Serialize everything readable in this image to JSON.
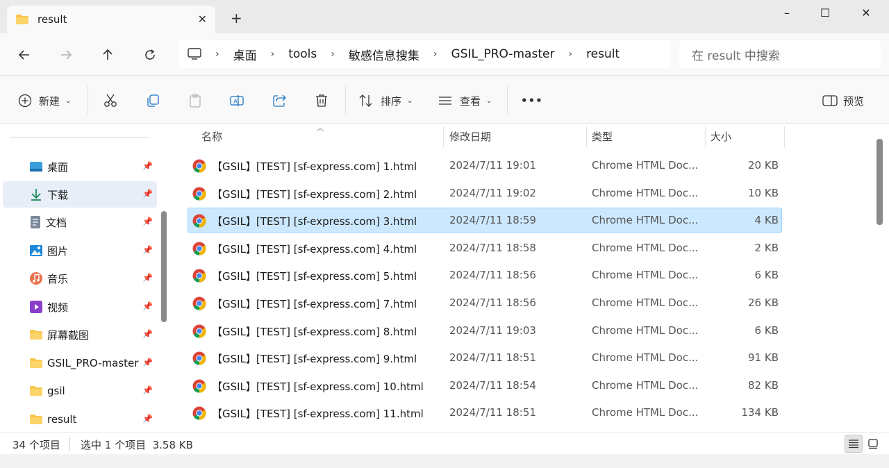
{
  "window": {
    "tab_title": "result",
    "new_tab": "+",
    "minimize": "–",
    "maximize": "☐",
    "close": "✕"
  },
  "address": {
    "crumbs": [
      "桌面",
      "tools",
      "敏感信息搜集",
      "GSIL_PRO-master",
      "result"
    ],
    "separator": "›"
  },
  "search": {
    "placeholder": "在 result 中搜索"
  },
  "toolbar": {
    "new_label": "新建",
    "sort_label": "排序",
    "view_label": "查看",
    "more_label": "•••",
    "preview_label": "预览"
  },
  "sidebar": {
    "items": [
      {
        "label": "桌面",
        "icon": "desktop-icon"
      },
      {
        "label": "下载",
        "icon": "download-icon"
      },
      {
        "label": "文档",
        "icon": "document-icon"
      },
      {
        "label": "图片",
        "icon": "picture-icon"
      },
      {
        "label": "音乐",
        "icon": "music-icon"
      },
      {
        "label": "视频",
        "icon": "video-icon"
      },
      {
        "label": "屏幕截图",
        "icon": "folder-icon"
      },
      {
        "label": "GSIL_PRO-master",
        "icon": "folder-icon"
      },
      {
        "label": "gsil",
        "icon": "folder-icon"
      },
      {
        "label": "result",
        "icon": "folder-icon"
      }
    ],
    "selected_index": 1
  },
  "columns": {
    "name": "名称",
    "date": "修改日期",
    "type": "类型",
    "size": "大小"
  },
  "files": [
    {
      "name": "【GSIL】[TEST] [sf-express.com] 1.html",
      "date": "2024/7/11 19:01",
      "type": "Chrome HTML Doc...",
      "size": "20 KB"
    },
    {
      "name": "【GSIL】[TEST] [sf-express.com] 2.html",
      "date": "2024/7/11 19:02",
      "type": "Chrome HTML Doc...",
      "size": "10 KB"
    },
    {
      "name": "【GSIL】[TEST] [sf-express.com] 3.html",
      "date": "2024/7/11 18:59",
      "type": "Chrome HTML Doc...",
      "size": "4 KB"
    },
    {
      "name": "【GSIL】[TEST] [sf-express.com] 4.html",
      "date": "2024/7/11 18:58",
      "type": "Chrome HTML Doc...",
      "size": "2 KB"
    },
    {
      "name": "【GSIL】[TEST] [sf-express.com] 5.html",
      "date": "2024/7/11 18:56",
      "type": "Chrome HTML Doc...",
      "size": "6 KB"
    },
    {
      "name": "【GSIL】[TEST] [sf-express.com] 7.html",
      "date": "2024/7/11 18:56",
      "type": "Chrome HTML Doc...",
      "size": "26 KB"
    },
    {
      "name": "【GSIL】[TEST] [sf-express.com] 8.html",
      "date": "2024/7/11 19:03",
      "type": "Chrome HTML Doc...",
      "size": "6 KB"
    },
    {
      "name": "【GSIL】[TEST] [sf-express.com] 9.html",
      "date": "2024/7/11 18:51",
      "type": "Chrome HTML Doc...",
      "size": "91 KB"
    },
    {
      "name": "【GSIL】[TEST] [sf-express.com] 10.html",
      "date": "2024/7/11 18:54",
      "type": "Chrome HTML Doc...",
      "size": "82 KB"
    },
    {
      "name": "【GSIL】[TEST] [sf-express.com] 11.html",
      "date": "2024/7/11 18:51",
      "type": "Chrome HTML Doc...",
      "size": "134 KB"
    }
  ],
  "selected_file_index": 2,
  "status": {
    "item_count": "34 个项目",
    "selection": "选中 1 个项目  3.58 KB"
  },
  "colors": {
    "selection_bg": "#cce8ff",
    "selection_border": "#99d1ff",
    "folder_yellow": "#f8c74a"
  }
}
